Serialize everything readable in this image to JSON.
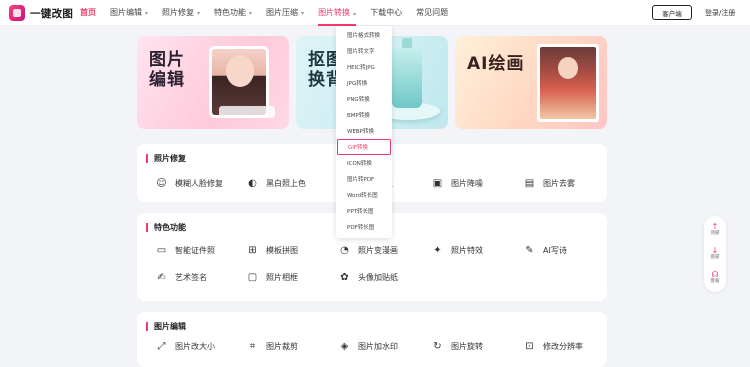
{
  "header": {
    "logo_text": "一键改图",
    "nav": [
      {
        "label": "首页",
        "chevron": false,
        "state": "active"
      },
      {
        "label": "图片编辑",
        "chevron": true,
        "state": ""
      },
      {
        "label": "照片修复",
        "chevron": true,
        "state": ""
      },
      {
        "label": "特色功能",
        "chevron": true,
        "state": ""
      },
      {
        "label": "图片压缩",
        "chevron": true,
        "state": ""
      },
      {
        "label": "图片转换",
        "chevron": true,
        "state": "hover"
      },
      {
        "label": "下载中心",
        "chevron": false,
        "state": ""
      },
      {
        "label": "常见问题",
        "chevron": false,
        "state": ""
      }
    ],
    "client_button": "客户端",
    "login": "登录/注册"
  },
  "banners": [
    {
      "title_line1": "图片",
      "title_line2": "编辑"
    },
    {
      "title_line1": "抠图",
      "title_line2": "换背"
    },
    {
      "title_line1": "AI绘画",
      "title_line2": ""
    }
  ],
  "dropdown": {
    "items": [
      "图片格式转换",
      "图片转文字",
      "HEIC转JPG",
      "JPG转换",
      "PNG转换",
      "BMP转换",
      "WEBP转换",
      "GIF转换",
      "ICON转换",
      "图片转PDF",
      "Word转长图",
      "PPT转长图",
      "PDF转长图"
    ],
    "highlighted": "GIF转换"
  },
  "sections": [
    {
      "title": "照片修复",
      "tools": [
        {
          "label": "模糊人脸修复",
          "icon": "face-smile-icon"
        },
        {
          "label": "黑白照上色",
          "icon": "palette-icon"
        },
        {
          "label": "复",
          "icon": ""
        },
        {
          "label": "图片降噪",
          "icon": "denoise-icon"
        },
        {
          "label": "图片去雾",
          "icon": "defog-icon"
        }
      ]
    },
    {
      "title": "特色功能",
      "tools": [
        {
          "label": "智能证件照",
          "icon": "id-photo-icon"
        },
        {
          "label": "模板拼图",
          "icon": "collage-icon"
        },
        {
          "label": "照片变漫画",
          "icon": "cartoon-icon"
        },
        {
          "label": "照片特效",
          "icon": "sparkle-icon"
        },
        {
          "label": "AI写诗",
          "icon": "ai-poem-icon"
        },
        {
          "label": "艺术签名",
          "icon": "signature-icon"
        },
        {
          "label": "照片相框",
          "icon": "frame-icon"
        },
        {
          "label": "头像加贴纸",
          "icon": "sticker-icon"
        }
      ]
    },
    {
      "title": "图片编辑",
      "tools": [
        {
          "label": "图片改大小",
          "icon": "resize-icon"
        },
        {
          "label": "图片裁剪",
          "icon": "crop-icon"
        },
        {
          "label": "图片加水印",
          "icon": "watermark-icon"
        },
        {
          "label": "图片旋转",
          "icon": "rotate-icon"
        },
        {
          "label": "修改分辨率",
          "icon": "resolution-icon"
        }
      ]
    }
  ],
  "floatbar": [
    {
      "label": "顶部",
      "icon": "arrow-up-icon"
    },
    {
      "label": "底部",
      "icon": "arrow-down-icon"
    },
    {
      "label": "客服",
      "icon": "headset-icon"
    }
  ],
  "colors": {
    "accent": "#f23a6a"
  }
}
